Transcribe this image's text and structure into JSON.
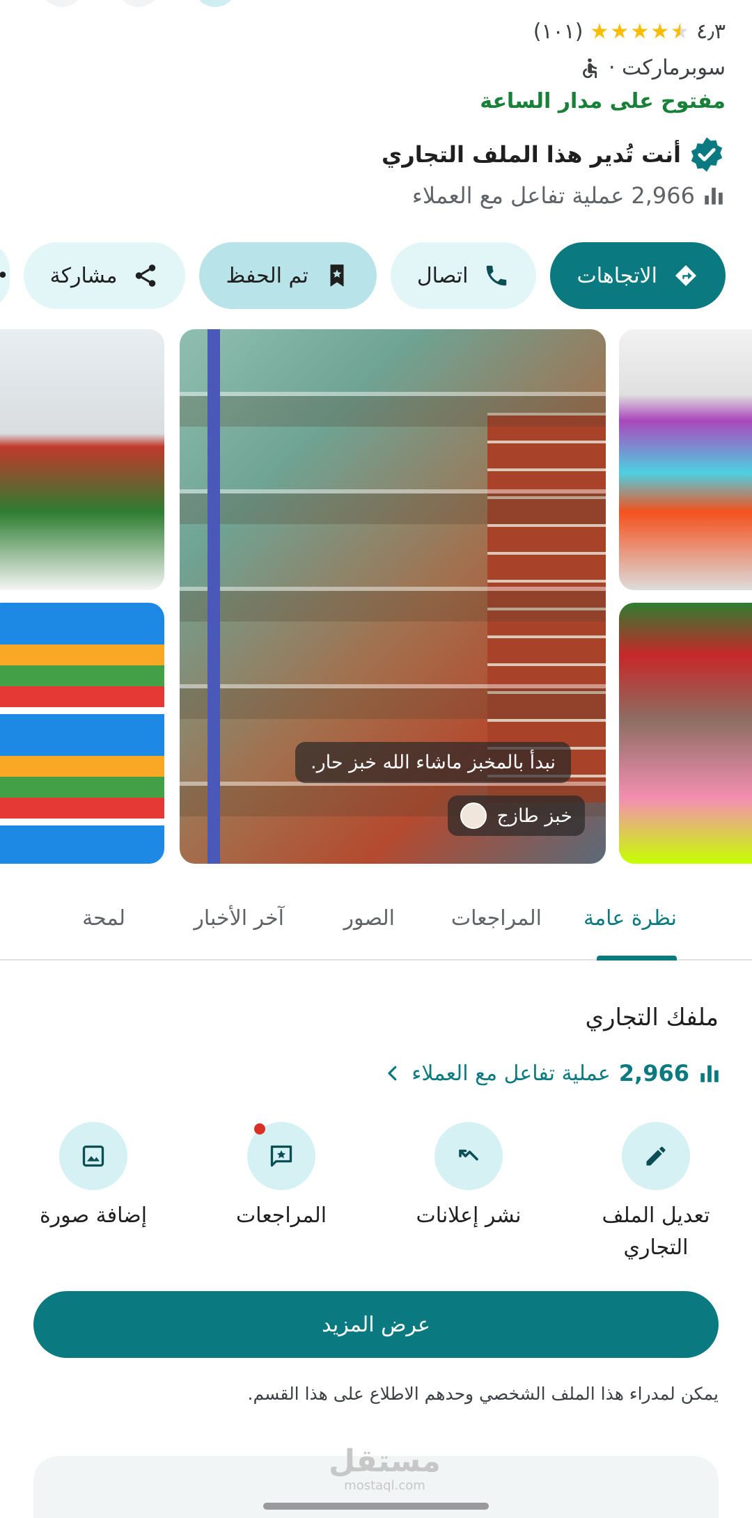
{
  "header": {
    "rating_value": "٤٫٣",
    "rating_count": "(١٠١)",
    "category": "سوبرماركت ·",
    "open_status": "مفتوح على مدار الساعة",
    "managed_text": "أنت تُدير هذا الملف التجاري",
    "interactions_count": "2,966",
    "interactions_text": "عملية تفاعل مع العملاء"
  },
  "icons": {
    "accessibility": "wheelchair-icon",
    "verified": "verified-badge-icon",
    "stats": "bar-chart-icon"
  },
  "chips": [
    {
      "label": "الاتجاهات",
      "icon": "directions-icon"
    },
    {
      "label": "اتصال",
      "icon": "phone-icon"
    },
    {
      "label": "تم الحفظ",
      "icon": "bookmark-icon"
    },
    {
      "label": "مشاركة",
      "icon": "share-icon"
    }
  ],
  "photo": {
    "caption": "نبدأ بالمخبز ماشاء الله خبز حار.",
    "author": "خبز طازج"
  },
  "tabs": [
    "نظرة عامة",
    "المراجعات",
    "الصور",
    "آخر الأخبار",
    "لمحة"
  ],
  "business": {
    "title": "ملفك التجاري",
    "count": "2,966",
    "link_text": "عملية تفاعل مع العملاء",
    "actions": [
      {
        "label": "تعديل الملف التجاري",
        "icon": "edit-icon"
      },
      {
        "label": "نشر إعلانات",
        "icon": "ads-trend-icon"
      },
      {
        "label": "المراجعات",
        "icon": "review-star-icon"
      },
      {
        "label": "إضافة صورة",
        "icon": "add-photo-icon"
      }
    ],
    "more_button": "عرض المزيد",
    "note": "يمكن لمدراء هذا الملف الشخصي وحدهم الاطلاع على هذا القسم."
  },
  "watermark": {
    "arabic": "مستقل",
    "latin": "mostaql.com"
  },
  "colors": {
    "accent": "#0b7a80",
    "open": "#188038",
    "star": "#fbbc04",
    "chip_bg": "#e2f6f8"
  }
}
